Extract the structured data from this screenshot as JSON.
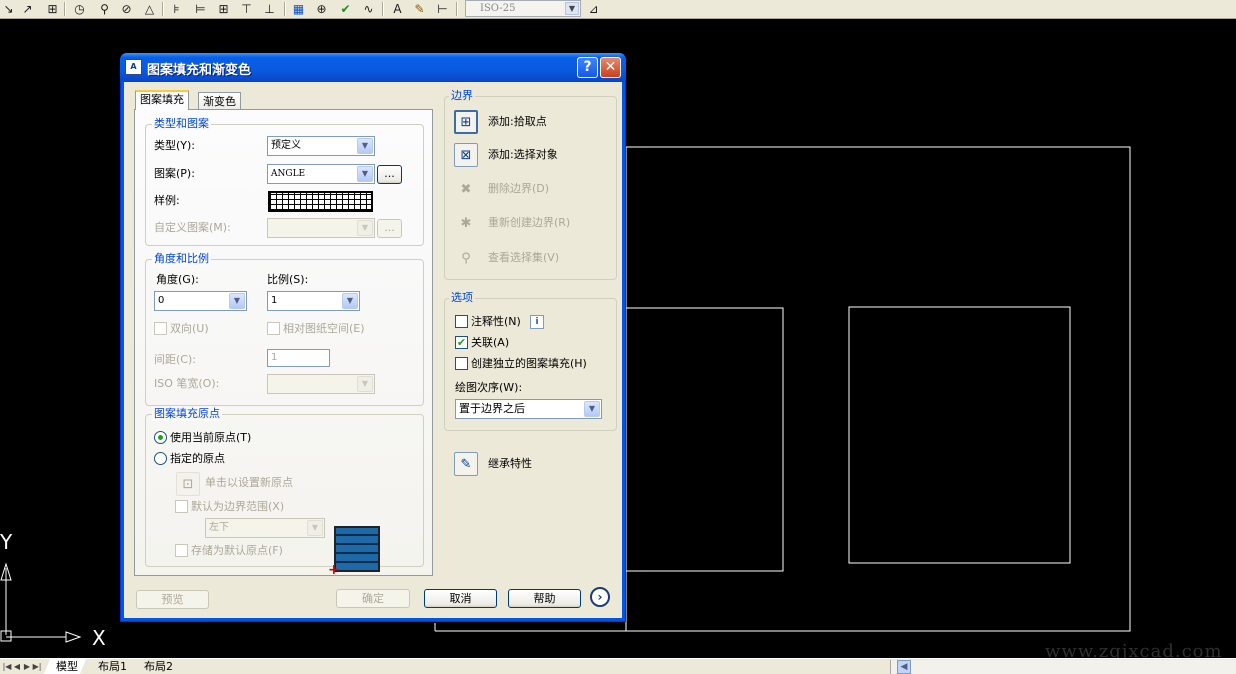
{
  "toolbar": {
    "dimstyle_value": "ISO-25",
    "icons": [
      "spline-icon",
      "arc-icon",
      "scale-icon",
      "angular-dim-icon",
      "radius-dim-icon",
      "diameter-dim-icon",
      "dim-angle-icon",
      "baseline-icon",
      "continue-icon",
      "ordinate-icon",
      "quick-leader-icon",
      "leader-icon",
      "tolerance-icon",
      "center-mark-icon",
      "inspect-icon",
      "jogged-icon",
      "dim-text-icon",
      "dim-edit-icon",
      "dim-update-icon",
      "dim-style-icon"
    ]
  },
  "canvas": {
    "ucs_x": "X",
    "ucs_y": "Y",
    "watermark": "www.zgjxcad.com"
  },
  "statusbar": {
    "tabs": [
      "模型",
      "布局1",
      "布局2"
    ]
  },
  "dialog": {
    "title": "图案填充和渐变色",
    "tabs": [
      "图案填充",
      "渐变色"
    ],
    "type_pattern": {
      "group_title": "类型和图案",
      "type_label": "类型(Y):",
      "type_value": "预定义",
      "pattern_label": "图案(P):",
      "pattern_value": "ANGLE",
      "pattern_browse": "...",
      "swatch_label": "样例:",
      "custom_label": "自定义图案(M):",
      "custom_value": "",
      "custom_browse": "..."
    },
    "angle_scale": {
      "group_title": "角度和比例",
      "angle_label": "角度(G):",
      "angle_value": "0",
      "scale_label": "比例(S):",
      "scale_value": "1",
      "double_label": "双向(U)",
      "relative_label": "相对图纸空间(E)",
      "spacing_label": "间距(C):",
      "spacing_value": "1",
      "iso_label": "ISO 笔宽(O):",
      "iso_value": ""
    },
    "origin": {
      "group_title": "图案填充原点",
      "use_current_label": "使用当前原点(T)",
      "specified_label": "指定的原点",
      "click_set_label": "单击以设置新原点",
      "default_extent_label": "默认为边界范围(X)",
      "position_value": "左下",
      "store_default_label": "存储为默认原点(F)"
    },
    "boundary": {
      "group_title": "边界",
      "add_pick_label": "添加:拾取点",
      "add_select_label": "添加:选择对象",
      "remove_label": "删除边界(D)",
      "recreate_label": "重新创建边界(R)",
      "view_label": "查看选择集(V)"
    },
    "options": {
      "group_title": "选项",
      "annotative_label": "注释性(N)",
      "associative_label": "关联(A)",
      "separate_label": "创建独立的图案填充(H)",
      "draw_order_label": "绘图次序(W):",
      "draw_order_value": "置于边界之后"
    },
    "inherit_label": "继承特性",
    "footer": {
      "preview": "预览",
      "ok": "确定",
      "cancel": "取消",
      "help": "帮助"
    }
  }
}
